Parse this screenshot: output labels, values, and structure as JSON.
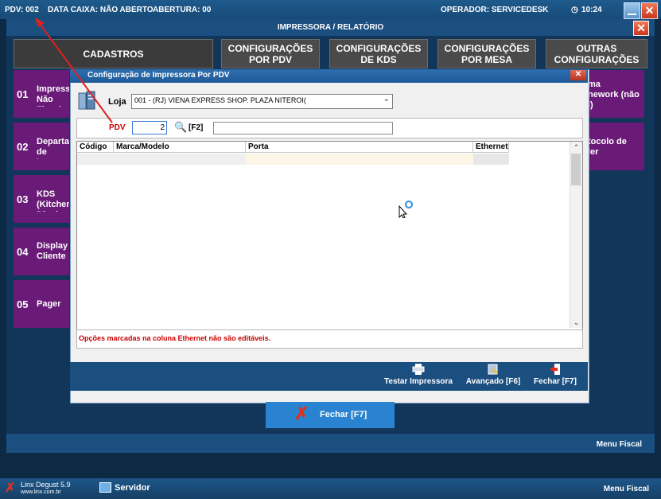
{
  "topbar": {
    "pdv": "PDV: 002",
    "caixa": "DATA CAIXA: NÃO ABERTO",
    "abertura": "ABERTURA: 00",
    "operador": "OPERADOR: SERVICEDESK",
    "clock": "10:24"
  },
  "main": {
    "title": "IMPRESSORA / RELATÓRIO",
    "tabs": [
      {
        "label": "CADASTROS"
      },
      {
        "label": "CONFIGURAÇÕES POR PDV"
      },
      {
        "label": "CONFIGURAÇÕES DE KDS"
      },
      {
        "label": "CONFIGURAÇÕES POR MESA"
      },
      {
        "label": "OUTRAS CONFIGURAÇÕES"
      }
    ],
    "left_items": [
      {
        "num": "01",
        "label": "Impressora Não Fiscal"
      },
      {
        "num": "02",
        "label": "Departamento de Impressão"
      },
      {
        "num": "03",
        "label": "KDS (Kitchen Display"
      },
      {
        "num": "04",
        "label": "Display Cliente"
      },
      {
        "num": "05",
        "label": "Pager"
      }
    ],
    "right_items": [
      {
        "label": "ma\nnework (não\nl)"
      },
      {
        "label": "tocolo de\nler"
      }
    ],
    "close_button_label": "Fechar [F7]",
    "menu_fiscal_top": "Menu Fiscal"
  },
  "modal": {
    "title": "Configuração de Impressora Por PDV",
    "loja_label": "Loja",
    "loja_value": "001 - (RJ) VIENA EXPRESS  SHOP. PLAZA NITEROI(",
    "pdv_label": "PDV",
    "pdv_value": "2",
    "f2_label": "[F2]",
    "pdv_desc": "",
    "grid_headers": [
      "Código",
      "Marca/Modelo",
      "Porta",
      "Ethernet"
    ],
    "note": "Opções marcadas na coluna Ethernet não são editáveis.",
    "actions": [
      {
        "label": "Testar Impressora",
        "icon": "printer-icon"
      },
      {
        "label": "Avançado [F6]",
        "icon": "settings-icon"
      },
      {
        "label": "Fechar [F7]",
        "icon": "exit-icon"
      }
    ]
  },
  "footer": {
    "app": "Linx Degust 5.9",
    "site": "www.linx.com.br",
    "server": "Servidor",
    "menu_fiscal": "Menu Fiscal"
  },
  "colors": {
    "purple": "#6a1a77",
    "blue_bar": "#1b4f80",
    "close_red": "#c8361b",
    "note_red": "#cc0000"
  }
}
